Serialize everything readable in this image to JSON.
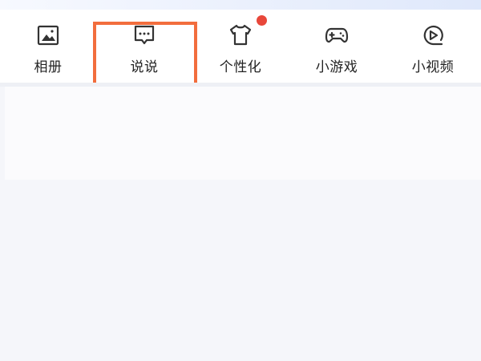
{
  "shortcuts": [
    {
      "label": "相册",
      "icon": "photo-album-icon"
    },
    {
      "label": "说说",
      "icon": "chat-bubble-icon"
    },
    {
      "label": "个性化",
      "icon": "tshirt-icon",
      "badge": "red-dot"
    },
    {
      "label": "小游戏",
      "icon": "gamepad-icon"
    },
    {
      "label": "小视频",
      "icon": "video-play-icon"
    }
  ],
  "colors": {
    "highlight": "#f26d3d",
    "badge": "#e8473a",
    "text": "#222222",
    "icon": "#333333"
  }
}
